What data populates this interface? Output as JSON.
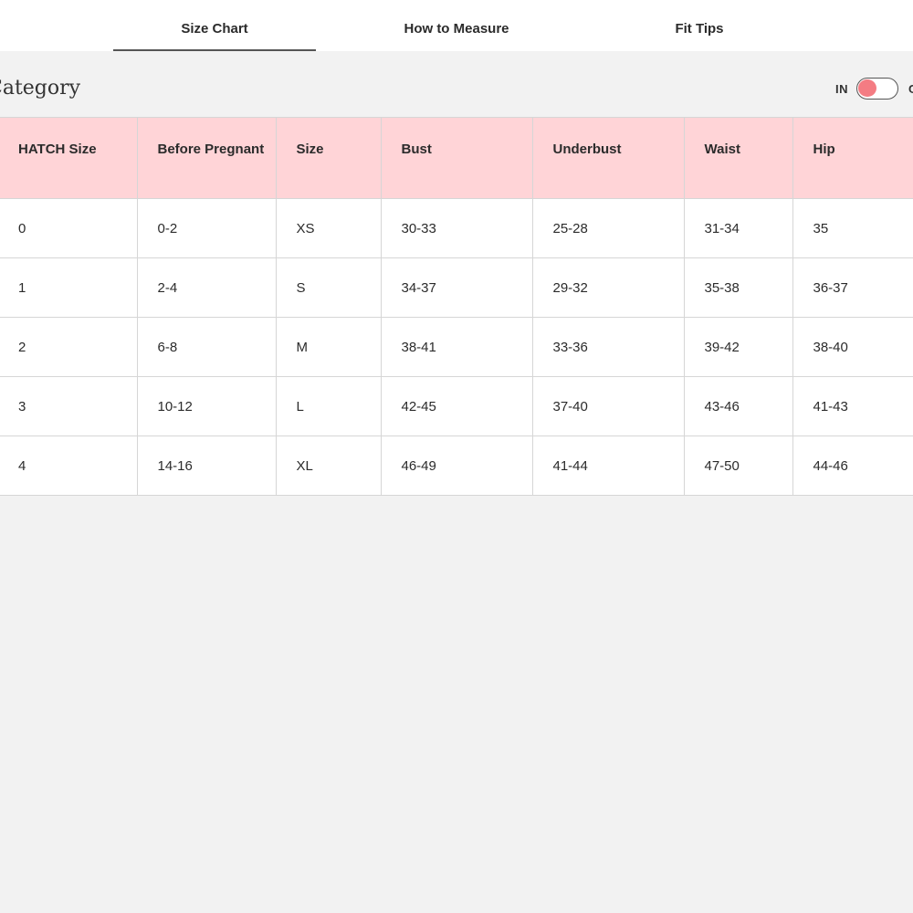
{
  "tabs": [
    {
      "label": "Size Chart",
      "active": true
    },
    {
      "label": "How to Measure",
      "active": false
    },
    {
      "label": "Fit Tips",
      "active": false
    }
  ],
  "category": {
    "title": "Category"
  },
  "units": {
    "left": "IN",
    "right": "C",
    "selected": "IN"
  },
  "colors": {
    "header_bg": "#ffd4d7",
    "toggle_knob": "#f47c83",
    "page_bg": "#f2f2f2"
  },
  "table": {
    "headers": [
      "HATCH Size",
      "Before Pregnant",
      "Size",
      "Bust",
      "Underbust",
      "Waist",
      "Hip"
    ],
    "rows": [
      [
        "0",
        "0-2",
        "XS",
        "30-33",
        "25-28",
        "31-34",
        "35"
      ],
      [
        "1",
        "2-4",
        "S",
        "34-37",
        "29-32",
        "35-38",
        "36-37"
      ],
      [
        "2",
        "6-8",
        "M",
        "38-41",
        "33-36",
        "39-42",
        "38-40"
      ],
      [
        "3",
        "10-12",
        "L",
        "42-45",
        "37-40",
        "43-46",
        "41-43"
      ],
      [
        "4",
        "14-16",
        "XL",
        "46-49",
        "41-44",
        "47-50",
        "44-46"
      ]
    ]
  }
}
